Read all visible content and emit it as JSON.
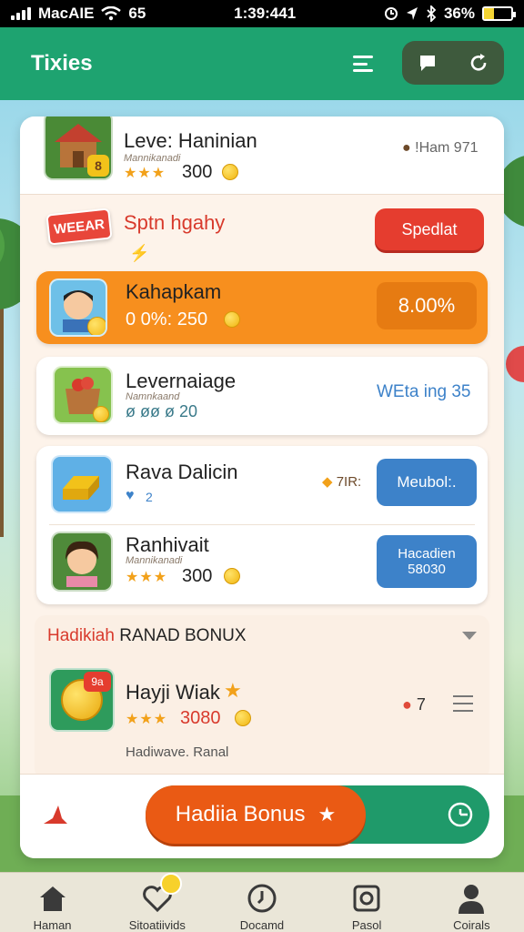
{
  "status_bar": {
    "carrier": "MacAIE",
    "misc": "65",
    "time": "1:39:441",
    "battery": "36%"
  },
  "header": {
    "title": "Tixies"
  },
  "level_row": {
    "title": "Leve: Haninian",
    "subtitle": "Mannikanadi",
    "stars": "★★★",
    "score": "300",
    "badge_num": "8",
    "right_info": "!Ham 971"
  },
  "promo": {
    "badge": "WEEAR",
    "title": "Sptn hgahy",
    "button": "Spedlat"
  },
  "items": [
    {
      "title": "Kahapkam",
      "stats": "0 0%: 250",
      "value": "8.00%"
    },
    {
      "title": "Levernaiage",
      "subtitle": "Namnkaand",
      "stats": "ø øø ø  20",
      "right_text": "WEta ing 35"
    },
    {
      "title": "Rava Dalicin",
      "hearts": "2",
      "mid_info": "7IR:",
      "button": "Meubol:."
    },
    {
      "title": "Ranhivait",
      "subtitle": "Mannikanadi",
      "stars": "★★★",
      "score": "300",
      "button_line1": "Hacadien",
      "button_line2": "58030"
    }
  ],
  "bonus_section": {
    "header_red": "Hadikiah",
    "header_black": "RANAD BONUX",
    "item_title": "Hayji Wiak",
    "item_badge": "9a",
    "item_stars": "★★★",
    "item_score": "3080",
    "item_count": "7",
    "item_footer": "Hadiwave. Ranal"
  },
  "bonus_button": {
    "label": "Hadiia Bonus"
  },
  "bottom_nav": [
    {
      "label": "Haman",
      "icon": "home-icon"
    },
    {
      "label": "Sitoatiivids",
      "icon": "heart-icon"
    },
    {
      "label": "Docamd",
      "icon": "clock-icon"
    },
    {
      "label": "Pasol",
      "icon": "square-icon"
    },
    {
      "label": "Coirals",
      "icon": "person-icon"
    }
  ],
  "colors": {
    "header_green": "#1ea370",
    "orange": "#f78f1e",
    "red": "#e53d2f",
    "blue": "#3d82c9",
    "bonus_orange": "#ea5a14"
  }
}
